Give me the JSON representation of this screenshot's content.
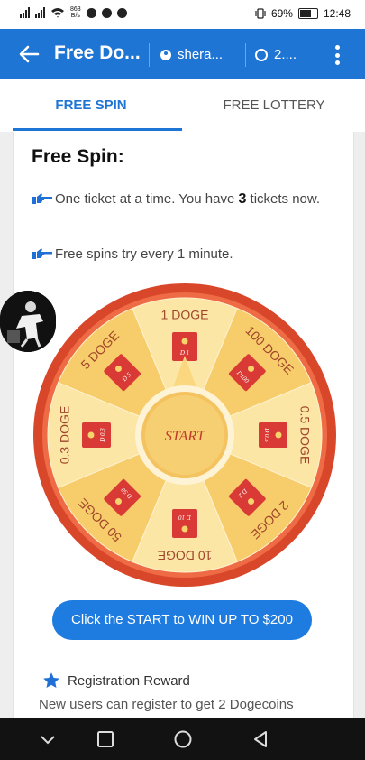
{
  "status_bar": {
    "net_speed_value": "863",
    "net_speed_unit": "B/s",
    "battery": "69%",
    "time": "12:48"
  },
  "app_bar": {
    "title": "Free Do...",
    "user_chip": "shera...",
    "balance_chip": "2...."
  },
  "tabs": [
    {
      "label": "FREE SPIN",
      "active": true
    },
    {
      "label": "FREE LOTTERY",
      "active": false
    }
  ],
  "free_spin": {
    "title": "Free Spin:",
    "line1_pre": "One ticket at a time. You have ",
    "ticket_count": "3",
    "line1_post": " tickets now.",
    "line2": "Free spins try every 1 minute."
  },
  "wheel": {
    "start_label": "START",
    "segments": [
      {
        "label": "1 DOGE",
        "ticket": "D 1"
      },
      {
        "label": "100 DOGE",
        "ticket": "D100"
      },
      {
        "label": "0.5 DOGE",
        "ticket": "D 0.5"
      },
      {
        "label": "2 DOGE",
        "ticket": "D 2"
      },
      {
        "label": "10 DOGE",
        "ticket": "D 10"
      },
      {
        "label": "50 DOGE",
        "ticket": "D 50"
      },
      {
        "label": "0.3 DOGE",
        "ticket": "D 0.3"
      },
      {
        "label": "5 DOGE",
        "ticket": "D 5"
      }
    ]
  },
  "cta_label": "Click the START to WIN UP TO $200",
  "registration": {
    "title": "Registration Reward",
    "description": "New users can register to get 2 Dogecoins"
  },
  "colors": {
    "primary": "#1e75d3",
    "wheel_rim": "#d9472b",
    "segment_light": "#fbe6a6",
    "segment_dark": "#f7cc6b",
    "ticket": "#d93a35"
  }
}
